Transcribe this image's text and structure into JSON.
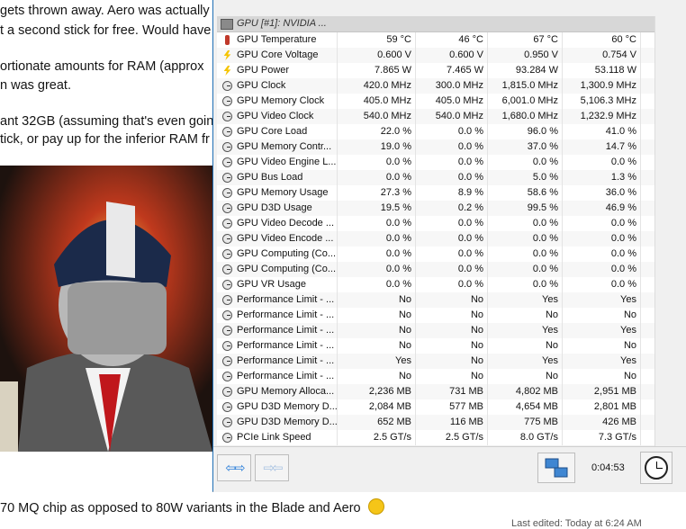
{
  "background_page": {
    "lines": [
      "gets thrown away. Aero was actually a",
      "t a second stick for free. Would have",
      "ortionate amounts for RAM (approx",
      "n was great.",
      "ant 32GB (assuming that's even goin",
      "tick, or pay up for the inferior RAM fr"
    ],
    "bottom_line": "70 MQ chip as opposed to 80W variants in the Blade and Aero",
    "last_edited": "Last edited: Today at 6:24 AM"
  },
  "window": {
    "group_label": "GPU [#1]: NVIDIA ...",
    "rows": [
      {
        "icon": "temperature-icon",
        "name": "GPU Temperature",
        "v": [
          "59 °C",
          "46 °C",
          "67 °C",
          "60 °C"
        ]
      },
      {
        "icon": "voltage-icon",
        "name": "GPU Core Voltage",
        "v": [
          "0.600 V",
          "0.600 V",
          "0.950 V",
          "0.754 V"
        ]
      },
      {
        "icon": "power-icon",
        "name": "GPU Power",
        "v": [
          "7.865 W",
          "7.465 W",
          "93.284 W",
          "53.118 W"
        ]
      },
      {
        "icon": "clock-icon",
        "name": "GPU Clock",
        "v": [
          "420.0 MHz",
          "300.0 MHz",
          "1,815.0 MHz",
          "1,300.9 MHz"
        ]
      },
      {
        "icon": "clock-icon",
        "name": "GPU Memory Clock",
        "v": [
          "405.0 MHz",
          "405.0 MHz",
          "6,001.0 MHz",
          "5,106.3 MHz"
        ]
      },
      {
        "icon": "clock-icon",
        "name": "GPU Video Clock",
        "v": [
          "540.0 MHz",
          "540.0 MHz",
          "1,680.0 MHz",
          "1,232.9 MHz"
        ]
      },
      {
        "icon": "clock-icon",
        "name": "GPU Core Load",
        "v": [
          "22.0 %",
          "0.0 %",
          "96.0 %",
          "41.0 %"
        ]
      },
      {
        "icon": "clock-icon",
        "name": "GPU Memory Contr...",
        "v": [
          "19.0 %",
          "0.0 %",
          "37.0 %",
          "14.7 %"
        ]
      },
      {
        "icon": "clock-icon",
        "name": "GPU Video Engine L...",
        "v": [
          "0.0 %",
          "0.0 %",
          "0.0 %",
          "0.0 %"
        ]
      },
      {
        "icon": "clock-icon",
        "name": "GPU Bus Load",
        "v": [
          "0.0 %",
          "0.0 %",
          "5.0 %",
          "1.3 %"
        ]
      },
      {
        "icon": "clock-icon",
        "name": "GPU Memory Usage",
        "v": [
          "27.3 %",
          "8.9 %",
          "58.6 %",
          "36.0 %"
        ]
      },
      {
        "icon": "clock-icon",
        "name": "GPU D3D Usage",
        "v": [
          "19.5 %",
          "0.2 %",
          "99.5 %",
          "46.9 %"
        ]
      },
      {
        "icon": "clock-icon",
        "name": "GPU Video Decode ...",
        "v": [
          "0.0 %",
          "0.0 %",
          "0.0 %",
          "0.0 %"
        ]
      },
      {
        "icon": "clock-icon",
        "name": "GPU Video Encode ...",
        "v": [
          "0.0 %",
          "0.0 %",
          "0.0 %",
          "0.0 %"
        ]
      },
      {
        "icon": "clock-icon",
        "name": "GPU Computing (Co...",
        "v": [
          "0.0 %",
          "0.0 %",
          "0.0 %",
          "0.0 %"
        ]
      },
      {
        "icon": "clock-icon",
        "name": "GPU Computing (Co...",
        "v": [
          "0.0 %",
          "0.0 %",
          "0.0 %",
          "0.0 %"
        ]
      },
      {
        "icon": "clock-icon",
        "name": "GPU VR Usage",
        "v": [
          "0.0 %",
          "0.0 %",
          "0.0 %",
          "0.0 %"
        ]
      },
      {
        "icon": "clock-icon",
        "name": "Performance Limit - ...",
        "v": [
          "No",
          "No",
          "Yes",
          "Yes"
        ]
      },
      {
        "icon": "clock-icon",
        "name": "Performance Limit - ...",
        "v": [
          "No",
          "No",
          "No",
          "No"
        ]
      },
      {
        "icon": "clock-icon",
        "name": "Performance Limit - ...",
        "v": [
          "No",
          "No",
          "Yes",
          "Yes"
        ]
      },
      {
        "icon": "clock-icon",
        "name": "Performance Limit - ...",
        "v": [
          "No",
          "No",
          "No",
          "No"
        ]
      },
      {
        "icon": "clock-icon",
        "name": "Performance Limit - ...",
        "v": [
          "Yes",
          "No",
          "Yes",
          "Yes"
        ]
      },
      {
        "icon": "clock-icon",
        "name": "Performance Limit - ...",
        "v": [
          "No",
          "No",
          "No",
          "No"
        ]
      },
      {
        "icon": "clock-icon",
        "name": "GPU Memory Alloca...",
        "v": [
          "2,236 MB",
          "731 MB",
          "4,802 MB",
          "2,951 MB"
        ]
      },
      {
        "icon": "clock-icon",
        "name": "GPU D3D Memory D...",
        "v": [
          "2,084 MB",
          "577 MB",
          "4,654 MB",
          "2,801 MB"
        ]
      },
      {
        "icon": "clock-icon",
        "name": "GPU D3D Memory D...",
        "v": [
          "652 MB",
          "116 MB",
          "775 MB",
          "426 MB"
        ]
      },
      {
        "icon": "clock-icon",
        "name": "PCIe Link Speed",
        "v": [
          "2.5 GT/s",
          "2.5 GT/s",
          "8.0 GT/s",
          "7.3 GT/s"
        ]
      }
    ]
  },
  "toolbar": {
    "timer": "0:04:53",
    "icons": [
      "nav-arrows-icon",
      "nav-arrows-disabled-icon",
      "network-icon",
      "clock-icon"
    ]
  },
  "colors": {
    "accent": "#2c7fd9",
    "group_bg": "#d7d7d7",
    "window_bg": "#f0f0f0"
  }
}
